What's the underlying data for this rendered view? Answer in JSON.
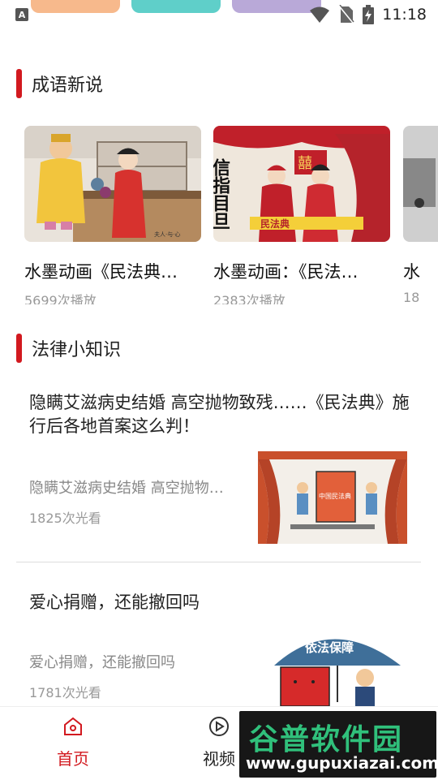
{
  "status_bar": {
    "left_icon": "A",
    "time": "11:18"
  },
  "sections": {
    "idioms_title": "成语新说",
    "law_title": "法律小知识"
  },
  "videos": [
    {
      "title": "水墨动画《民法典…",
      "plays": "5699次播放",
      "thumb_text": "夫人·与·心"
    },
    {
      "title": "水墨动画：《民法…",
      "plays": "2383次播放",
      "thumb_big": "信指目旦",
      "thumb_banner": "民法典"
    },
    {
      "title": "水",
      "plays": "18"
    }
  ],
  "articles": [
    {
      "headline": "隐瞒艾滋病史结婚 高空抛物致残……《民法典》施行后各地首案这么判！",
      "subtitle": "隐瞒艾滋病史结婚 高空抛物…",
      "views": "1825次光看",
      "thumb_text": "中国民法典"
    },
    {
      "headline": "爱心捐赠，还能撤回吗",
      "subtitle": "爱心捐赠，还能撤回吗",
      "views": "1781次光看",
      "thumb_text": "依法保障"
    }
  ],
  "bottom_nav": {
    "home_label": "首页",
    "video_label": "视频",
    "accent": "#d2191f"
  },
  "watermark": {
    "title": "谷普软件园",
    "url": "www.gupuxiazai.com"
  }
}
